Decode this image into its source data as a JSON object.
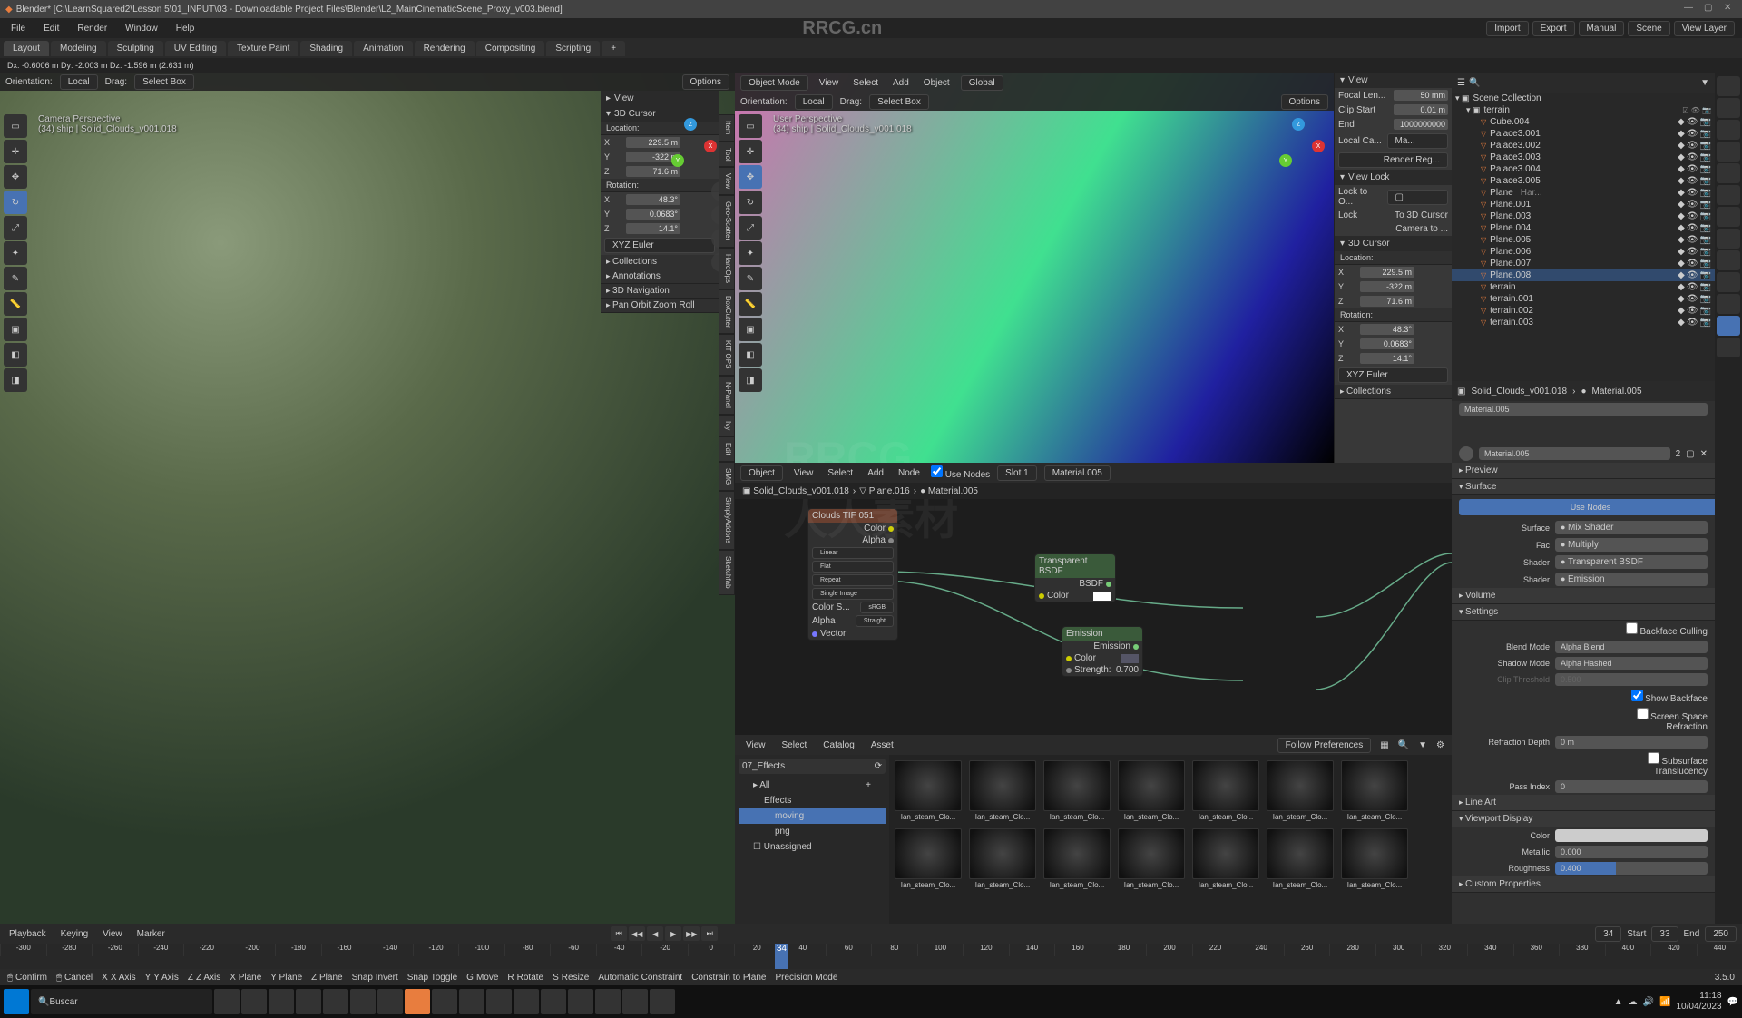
{
  "window": {
    "title": "Blender* [C:\\LearnSquared2\\Lesson 5\\01_INPUT\\03 - Downloadable Project Files\\Blender\\L2_MainCinematicScene_Proxy_v003.blend]",
    "version": "3.5.0"
  },
  "watermark": "RRCG.cn",
  "menubar": [
    "File",
    "Edit",
    "Render",
    "Window",
    "Help"
  ],
  "workspaces": [
    "Layout",
    "Modeling",
    "Sculpting",
    "UV Editing",
    "Texture Paint",
    "Shading",
    "Animation",
    "Rendering",
    "Compositing",
    "Scripting"
  ],
  "active_workspace": "Layout",
  "header_right": {
    "import": "Import",
    "export": "Export",
    "manual": "Manual",
    "scene": "Scene",
    "viewlayer": "View Layer"
  },
  "status_line": "Dx: -0.6006 m   Dy: -2.003 m   Dz: -1.596 m (2.631 m)",
  "viewport_left": {
    "header": {
      "orientation_lbl": "Orientation:",
      "orientation": "Local",
      "drag_lbl": "Drag:",
      "drag": "Select Box",
      "options": "Options"
    },
    "mode": "Object Mode",
    "view_menu": [
      "View",
      "Select",
      "Add",
      "Object"
    ],
    "global": "Global",
    "persp_label": "Camera Perspective",
    "context": "(34) ship | Solid_Clouds_v001.018",
    "npanel": {
      "view_head": "View",
      "cursor_head": "3D Cursor",
      "loc_head": "Location:",
      "x": "229.5 m",
      "y": "-322 m",
      "z": "71.6 m",
      "rot_head": "Rotation:",
      "rx": "48.3°",
      "ry": "0.0683°",
      "rz": "14.1°",
      "euler": "XYZ Euler",
      "sections": [
        "Collections",
        "Annotations",
        "3D Navigation",
        "Pan Orbit Zoom Roll"
      ]
    },
    "side_tabs": [
      "Item",
      "Tool",
      "View",
      "Geo-Scatter",
      "HardOps",
      "BoxCutter",
      "KIT OPS",
      "N-Panel",
      "Ivy",
      "Edit",
      "SMG",
      "SimplyAddons",
      "Sketchfab"
    ]
  },
  "viewport_right": {
    "persp_label": "User Perspective",
    "context": "(34) ship | Solid_Clouds_v001.018",
    "npanel": {
      "view_head": "View",
      "focal_lbl": "Focal Len...",
      "focal": "50 mm",
      "clip_start_lbl": "Clip Start",
      "clip_start": "0.01 m",
      "clip_end_lbl": "End",
      "clip_end": "1000000000",
      "localcam_lbl": "Local Ca...",
      "localcam_val": "Ma...",
      "render_reg": "Render Reg...",
      "viewlock_head": "View Lock",
      "lock_to_lbl": "Lock to O...",
      "lock_lbl": "Lock",
      "lock_val": "To 3D Cursor",
      "camera_to": "Camera to ...",
      "cursor_head": "3D Cursor",
      "loc_head": "Location:",
      "x": "229.5 m",
      "y": "-322 m",
      "z": "71.6 m",
      "rot_head": "Rotation:",
      "rx": "48.3°",
      "ry": "0.0683°",
      "rz": "14.1°",
      "euler": "XYZ Euler",
      "collections": "Collections"
    }
  },
  "shader": {
    "header": {
      "object": "Object",
      "view": "View",
      "select": "Select",
      "add": "Add",
      "node": "Node",
      "use_nodes": "Use Nodes",
      "slot": "Slot 1",
      "material": "Material.005"
    },
    "breadcrumb": {
      "world": "Solid_Clouds_v001.018",
      "obj": "Plane.016",
      "mat": "Material.005"
    },
    "nodes": {
      "imgtex": {
        "title": "Clouds TIF 051",
        "out_color": "Color",
        "out_alpha": "Alpha",
        "linear": "Linear",
        "flat": "Flat",
        "repeat": "Repeat",
        "single": "Single Image",
        "cs": "sRGB",
        "cspace": "Color S...",
        "alpha_s": "Alpha",
        "vector": "Vector"
      },
      "transp": {
        "title": "Transparent BSDF",
        "out": "BSDF",
        "color": "Color"
      },
      "emiss": {
        "title": "Emission",
        "out": "Emission",
        "color": "Color",
        "strength_lbl": "Strength:",
        "strength": "0.700"
      }
    }
  },
  "assets": {
    "header": {
      "view": "View",
      "select": "Select",
      "catalog": "Catalog",
      "asset": "Asset",
      "follow": "Follow Preferences"
    },
    "lib": "07_Effects",
    "tree": {
      "all": "All",
      "effects": "Effects",
      "moving": "moving",
      "png": "png",
      "unassigned": "Unassigned"
    },
    "items": [
      "Ian_steam_Clo...",
      "Ian_steam_Clo...",
      "Ian_steam_Clo...",
      "Ian_steam_Clo...",
      "Ian_steam_Clo...",
      "Ian_steam_Clo...",
      "Ian_steam_Clo...",
      "Ian_steam_Clo...",
      "Ian_steam_Clo...",
      "Ian_steam_Clo...",
      "Ian_steam_Clo...",
      "Ian_steam_Clo...",
      "Ian_steam_Clo...",
      "Ian_steam_Clo..."
    ]
  },
  "outliner": {
    "scene_coll": "Scene Collection",
    "terrain": "terrain",
    "items": [
      {
        "name": "Cube.004",
        "muted": true
      },
      {
        "name": "Palace3.001"
      },
      {
        "name": "Palace3.002"
      },
      {
        "name": "Palace3.003"
      },
      {
        "name": "Palace3.004"
      },
      {
        "name": "Palace3.005"
      },
      {
        "name": "Plane",
        "ext": "Har..."
      },
      {
        "name": "Plane.001"
      },
      {
        "name": "Plane.003"
      },
      {
        "name": "Plane.004"
      },
      {
        "name": "Plane.005"
      },
      {
        "name": "Plane.006"
      },
      {
        "name": "Plane.007"
      },
      {
        "name": "Plane.008",
        "sel": true
      },
      {
        "name": "terrain",
        "muted": true
      },
      {
        "name": "terrain.001",
        "muted": true
      },
      {
        "name": "terrain.002",
        "muted": true
      },
      {
        "name": "terrain.003",
        "muted": true
      }
    ]
  },
  "props": {
    "breadcrumb": {
      "obj": "Solid_Clouds_v001.018",
      "mat": "Material.005"
    },
    "mat_name": "Material.005",
    "preview": "Preview",
    "surface": "Surface",
    "use_nodes": "Use Nodes",
    "surface_lbl": "Surface",
    "surface_val": "Mix Shader",
    "fac_lbl": "Fac",
    "fac_val": "Multiply",
    "shader1_lbl": "Shader",
    "shader1_val": "Transparent BSDF",
    "shader2_lbl": "Shader",
    "shader2_val": "Emission",
    "volume": "Volume",
    "settings": "Settings",
    "backface": "Backface Culling",
    "blend_lbl": "Blend Mode",
    "blend_val": "Alpha Blend",
    "shadow_lbl": "Shadow Mode",
    "shadow_val": "Alpha Hashed",
    "clip_lbl": "Clip Threshold",
    "clip_val": "0.500",
    "show_backface": "Show Backface",
    "ssr": "Screen Space Refraction",
    "refr_lbl": "Refraction Depth",
    "refr_val": "0 m",
    "sss": "Subsurface Translucency",
    "pass_lbl": "Pass Index",
    "pass_val": "0",
    "lineart": "Line Art",
    "vp_display": "Viewport Display",
    "color_lbl": "Color",
    "metallic_lbl": "Metallic",
    "metallic_val": "0.000",
    "rough_lbl": "Roughness",
    "rough_val": "0.400",
    "custom": "Custom Properties"
  },
  "timeline": {
    "menu": [
      "Playback",
      "Keying",
      "View",
      "Marker"
    ],
    "frame": "34",
    "frame_right": "34",
    "start_lbl": "Start",
    "start": "33",
    "end_lbl": "End",
    "end": "250",
    "ticks": [
      "-300",
      "-280",
      "-260",
      "-240",
      "-220",
      "-200",
      "-180",
      "-160",
      "-140",
      "-120",
      "-100",
      "-80",
      "-60",
      "-40",
      "-20",
      "0",
      "20",
      "40",
      "60",
      "80",
      "100",
      "120",
      "140",
      "160",
      "180",
      "200",
      "220",
      "240",
      "260",
      "280",
      "300",
      "320",
      "340",
      "360",
      "380",
      "400",
      "420",
      "440"
    ]
  },
  "statusbar": {
    "items": [
      "Confirm",
      "Cancel",
      "X Axis",
      "Y Axis",
      "Z Axis",
      "X Plane",
      "Y Plane",
      "Z Plane",
      "Snap Invert",
      "Snap Toggle",
      "Move",
      "Rotate",
      "Resize",
      "Automatic Constraint",
      "Constrain to Plane",
      "Precision Mode"
    ]
  },
  "taskbar": {
    "search": "Buscar",
    "time": "11:18",
    "date": "10/04/2023"
  }
}
